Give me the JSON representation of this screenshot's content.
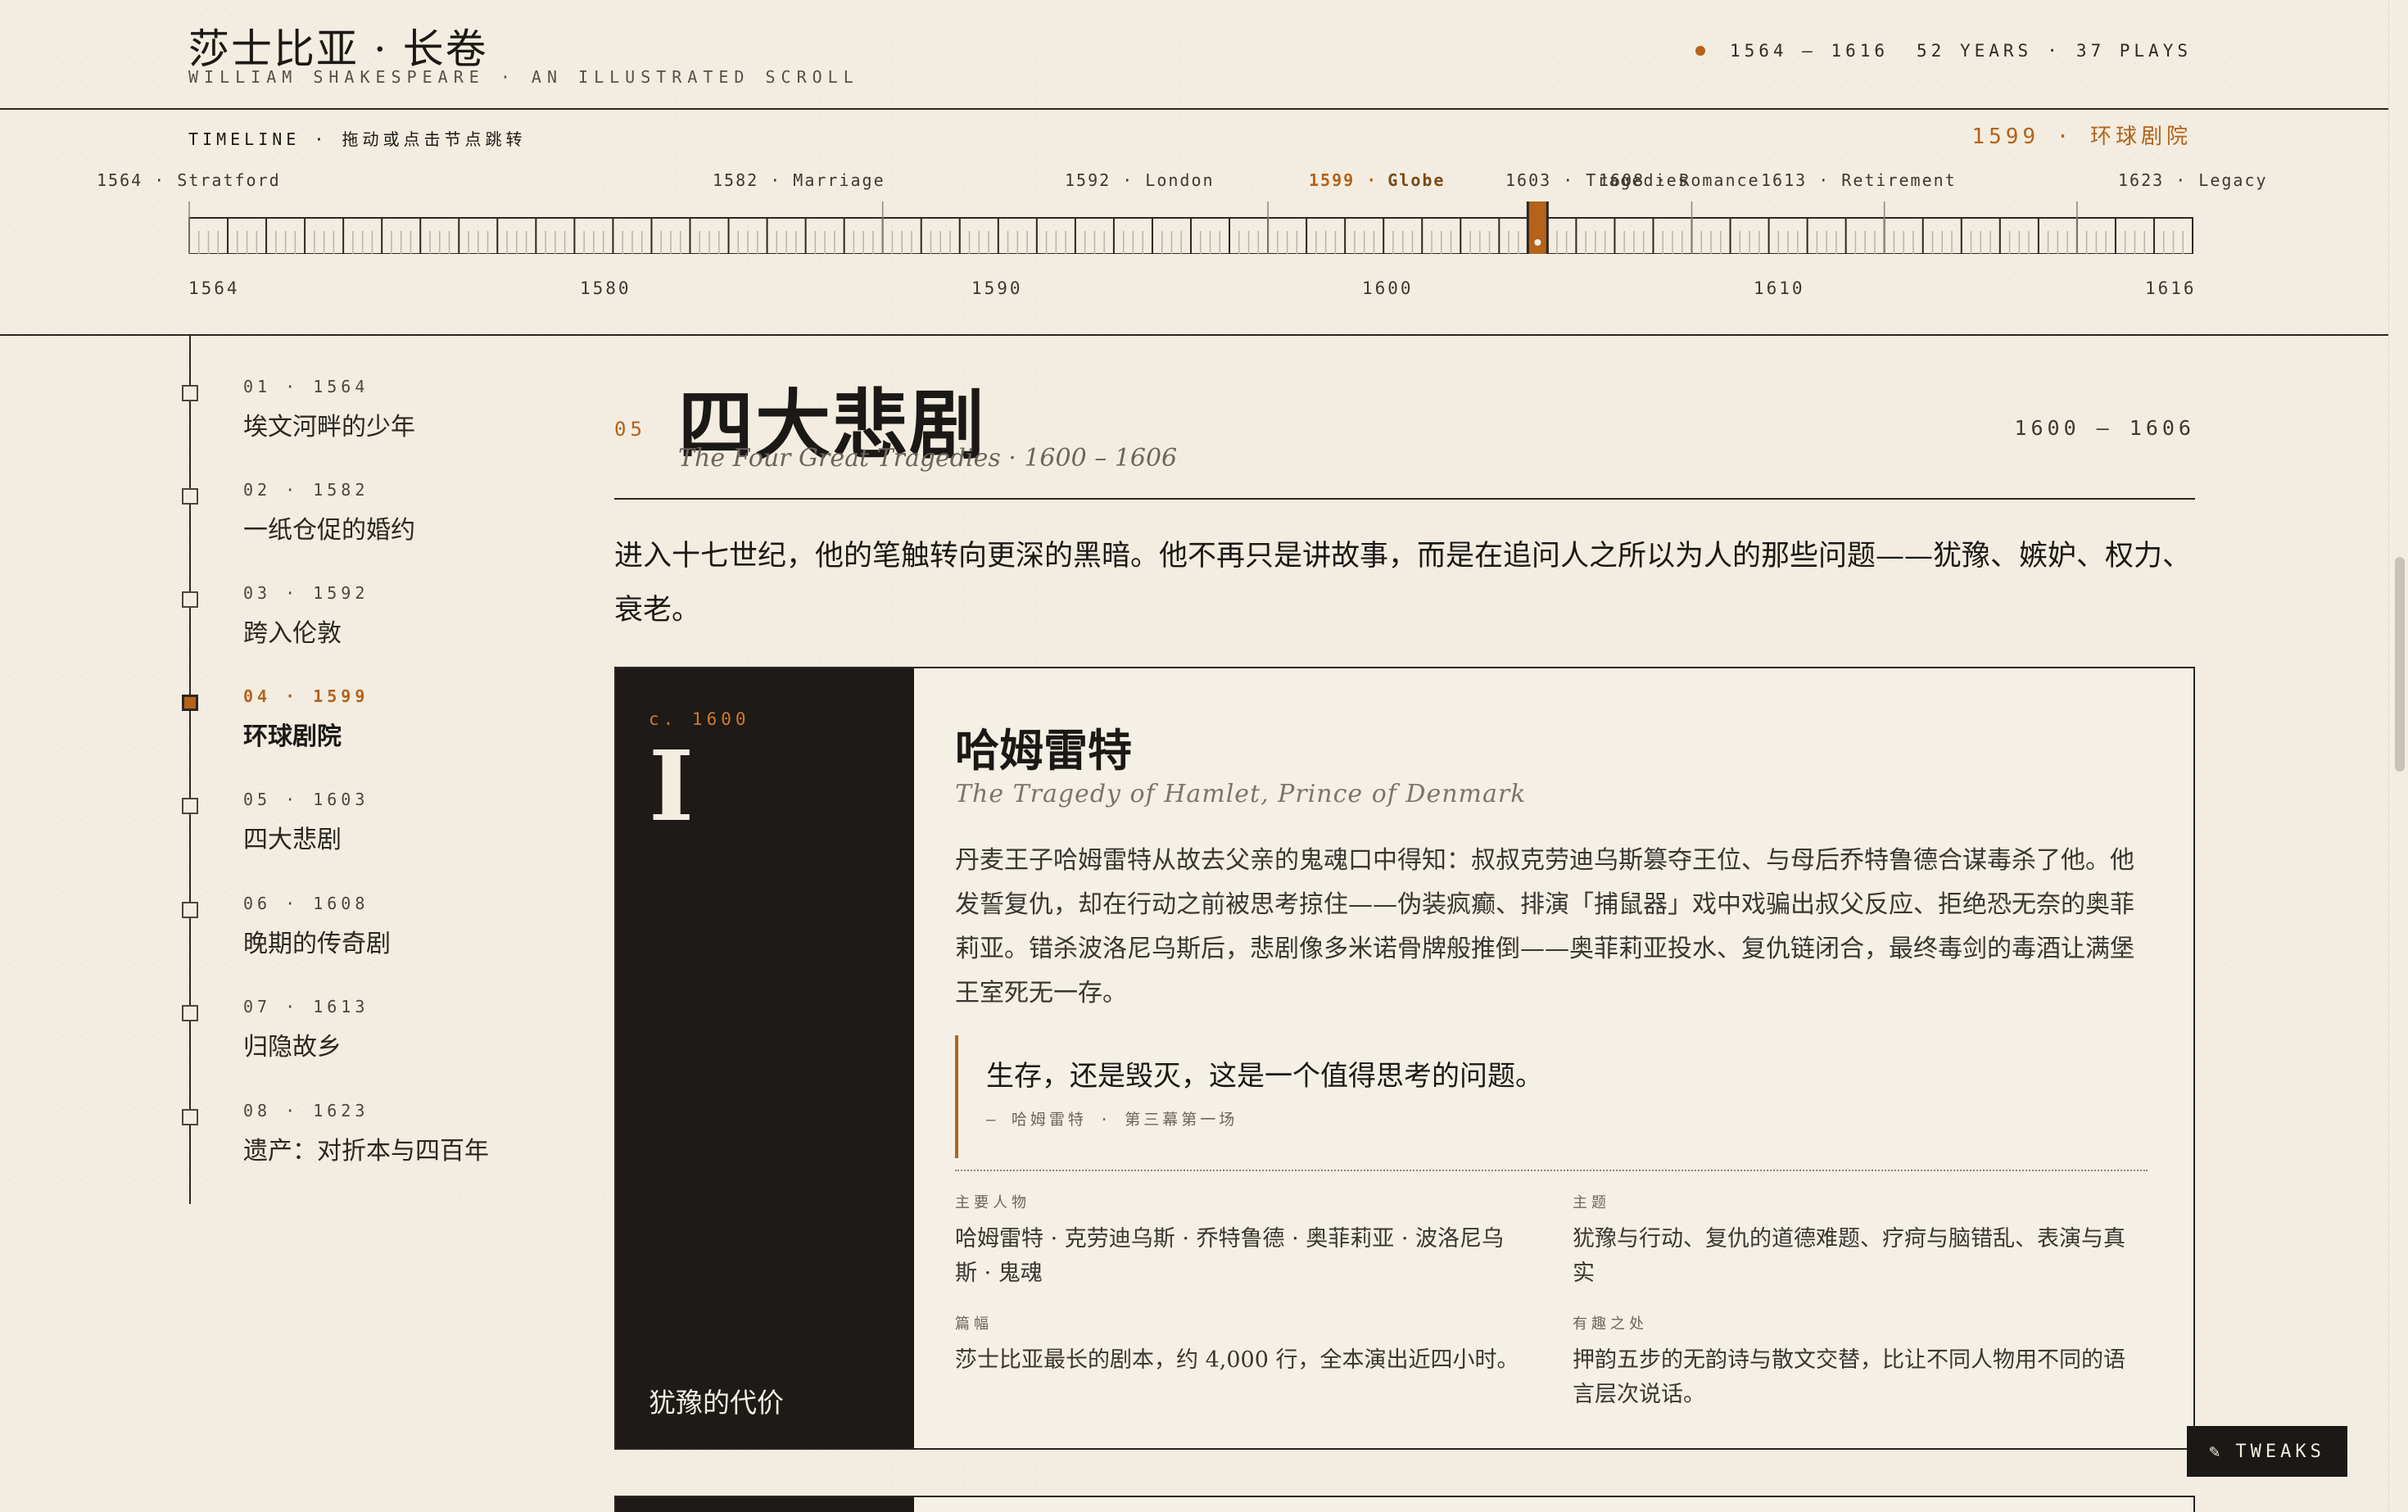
{
  "header": {
    "title": "莎士比亚 · 长卷",
    "subtitle": "WILLIAM SHAKESPEARE · AN ILLUSTRATED SCROLL",
    "stats": {
      "years_range": "1564 – 1616",
      "years": "52 YEARS",
      "separator": "·",
      "plays": "37 PLAYS"
    },
    "accent_color": "#b5621a"
  },
  "timeline": {
    "label": "TIMELINE · 拖动或点击节点跳转",
    "current": "1599 · 环球剧院",
    "start_year": 1564,
    "end_year": 1616,
    "current_year": 1599,
    "events": [
      {
        "year": "1564",
        "label": "1564 · Stratford",
        "active": false
      },
      {
        "year": "1582",
        "label": "1582 · Marriage",
        "active": false
      },
      {
        "year": "1592",
        "label": "1592 · London",
        "active": false
      },
      {
        "year": "1599",
        "label": "1599 ·",
        "label_rest": "Globe",
        "active": true
      },
      {
        "year": "1603",
        "label": "1603 · Tragedies",
        "active": false
      },
      {
        "year": "1608",
        "label": "1608 · Romance",
        "active": false
      },
      {
        "year": "1613",
        "label": "1613 · Retirement",
        "active": false
      },
      {
        "year": "1623",
        "label": "1623 · Legacy",
        "active": false
      }
    ],
    "axis_years": [
      "1564",
      "1580",
      "1590",
      "1600",
      "1610",
      "1616"
    ]
  },
  "sidebar": {
    "items": [
      {
        "meta": "01 · 1564",
        "title": "埃文河畔的少年",
        "active": false
      },
      {
        "meta": "02 · 1582",
        "title": "一纸仓促的婚约",
        "active": false
      },
      {
        "meta": "03 · 1592",
        "title": "跨入伦敦",
        "active": false
      },
      {
        "meta": "04 · 1599",
        "title": "环球剧院",
        "active": true
      },
      {
        "meta": "05 · 1603",
        "title": "四大悲剧",
        "active": false
      },
      {
        "meta": "06 · 1608",
        "title": "晚期的传奇剧",
        "active": false
      },
      {
        "meta": "07 · 1613",
        "title": "归隐故乡",
        "active": false
      },
      {
        "meta": "08 · 1623",
        "title": "遗产：对折本与四百年",
        "active": false
      }
    ]
  },
  "section": {
    "number": "05",
    "title": "四大悲剧",
    "subtitle": "The Four Great Tragedies · 1600 – 1606",
    "range": "1600 – 1606",
    "intro": "进入十七世纪，他的笔触转向更深的黑暗。他不再只是讲故事，而是在追问人之所以为人的那些问题——犹豫、嫉妒、权力、衰老。"
  },
  "card": {
    "year": "c. 1600",
    "roman": "I",
    "theme": "犹豫的代价",
    "title": "哈姆雷特",
    "subtitle": "The Tragedy of Hamlet, Prince of Denmark",
    "synopsis": "丹麦王子哈姆雷特从故去父亲的鬼魂口中得知：叔叔克劳迪乌斯篡夺王位、与母后乔特鲁德合谋毒杀了他。他发誓复仇，却在行动之前被思考掠住——伪装疯癫、排演「捕鼠器」戏中戏骗出叔父反应、拒绝恐无奈的奥菲莉亚。错杀波洛尼乌斯后，悲剧像多米诺骨牌般推倒——奥菲莉亚投水、复仇链闭合，最终毒剑的毒酒让满堡王室死无一存。",
    "quote": "生存，还是毁灭，这是一个值得思考的问题。",
    "quote_source": "— 哈姆雷特 · 第三幕第一场",
    "facts": {
      "characters_label": "主要人物",
      "characters": "哈姆雷特 · 克劳迪乌斯 · 乔特鲁德 · 奥菲莉亚 · 波洛尼乌斯 · 鬼魂",
      "themes_label": "主题",
      "themes": "犹豫与行动、复仇的道德难题、疗疴与脑错乱、表演与真实",
      "length_label": "篇幅",
      "length": "莎士比亚最长的剧本，约 4,000 行，全本演出近四小时。",
      "trivia_label": "有趣之处",
      "trivia": "押韵五步的无韵诗与散文交替，比让不同人物用不同的语言层次说话。"
    }
  },
  "tweaks": {
    "icon": "pencil-icon",
    "label": "TWEAKS"
  }
}
